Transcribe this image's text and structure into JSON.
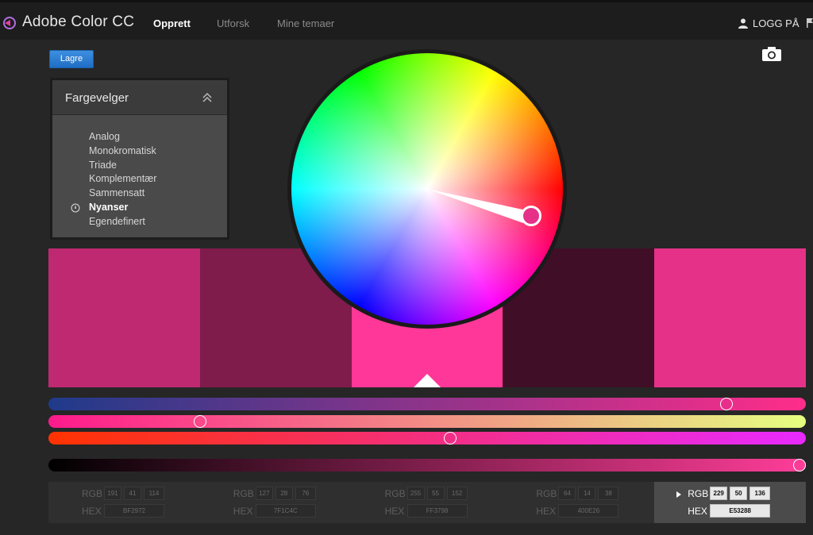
{
  "header": {
    "app_title": "Adobe Color CC",
    "nav": [
      {
        "label": "Opprett",
        "active": true
      },
      {
        "label": "Utforsk",
        "active": false
      },
      {
        "label": "Mine temaer",
        "active": false
      }
    ],
    "login_label": "LOGG PÅ"
  },
  "toolbar": {
    "save_label": "Lagre"
  },
  "rule_panel": {
    "title": "Fargevelger",
    "items": [
      {
        "label": "Analog",
        "selected": false
      },
      {
        "label": "Monokromatisk",
        "selected": false
      },
      {
        "label": "Triade",
        "selected": false
      },
      {
        "label": "Komplementær",
        "selected": false
      },
      {
        "label": "Sammensatt",
        "selected": false
      },
      {
        "label": "Nyanser",
        "selected": true
      },
      {
        "label": "Egendefinert",
        "selected": false
      }
    ]
  },
  "swatches": [
    {
      "color": "#BF2972",
      "rgb": [
        191,
        41,
        114
      ],
      "hex": "BF2972",
      "active": false
    },
    {
      "color": "#7F1C4C",
      "rgb": [
        127,
        28,
        76
      ],
      "hex": "7F1C4C",
      "active": false
    },
    {
      "color": "#FF3798",
      "rgb": [
        255,
        55,
        152
      ],
      "hex": "FF3798",
      "active": false
    },
    {
      "color": "#400E26",
      "rgb": [
        64,
        14,
        38
      ],
      "hex": "400E26",
      "active": false
    },
    {
      "color": "#E53288",
      "rgb": [
        229,
        50,
        136
      ],
      "hex": "E53288",
      "active": true
    }
  ],
  "labels": {
    "rgb": "RGB",
    "hex": "HEX"
  },
  "wheel": {
    "marker_color": "#E53288"
  },
  "sliders": [
    {
      "name": "slider-1",
      "gradient": [
        "#1f3a8a",
        "#ff2d8a"
      ],
      "value": 0.895
    },
    {
      "name": "slider-2",
      "gradient": [
        "#ff1a8c",
        "#e6ff80"
      ],
      "value": 0.2
    },
    {
      "name": "slider-3",
      "gradient": [
        "#ff3300",
        "#e82aff"
      ],
      "value": 0.53
    },
    {
      "name": "brightness-slider",
      "gradient": [
        "#000000",
        "#ff3d99"
      ],
      "value": 1.0
    }
  ]
}
